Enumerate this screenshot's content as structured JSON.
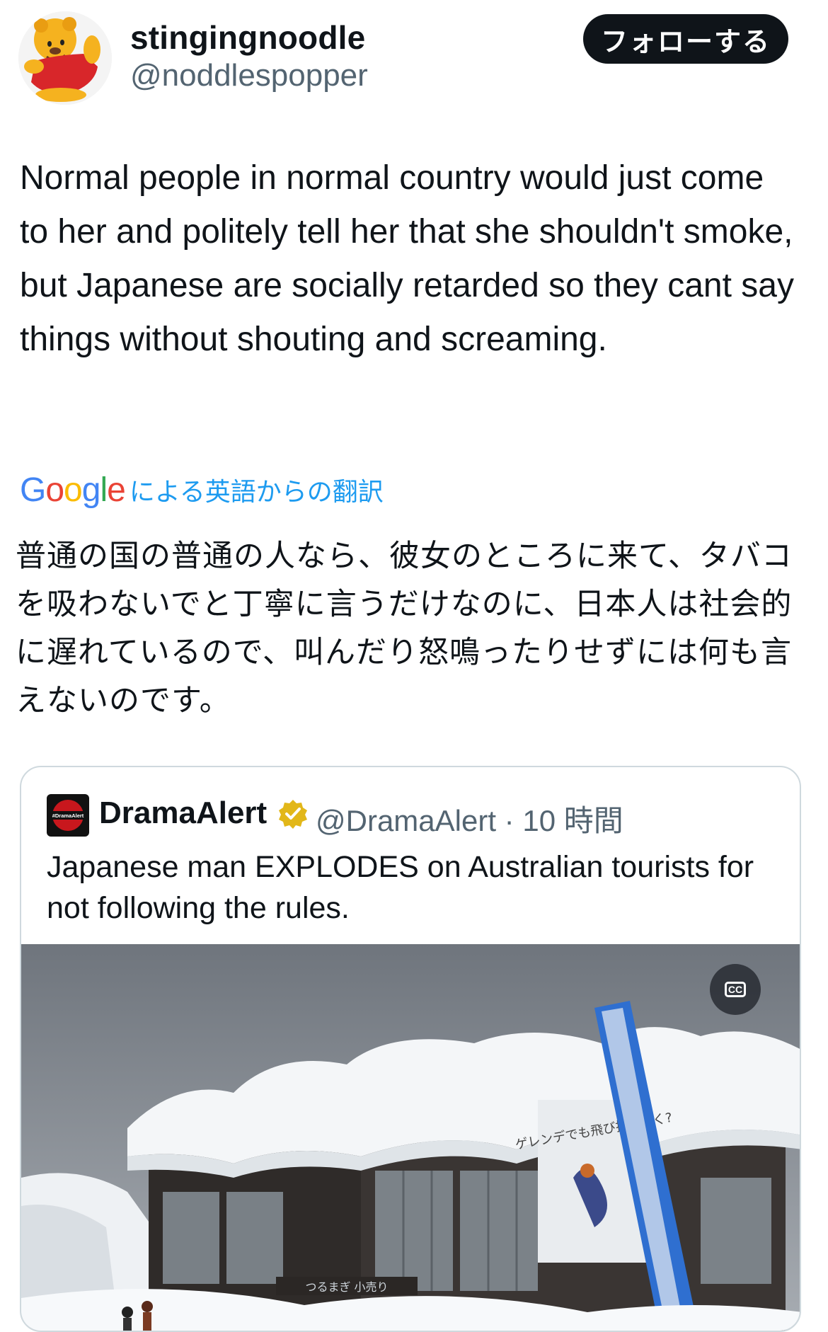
{
  "author": {
    "display_name": "stingingnoodle",
    "handle": "@noddlespopper",
    "avatar_icon": "pooh-bear-avatar"
  },
  "follow_button": {
    "label": "フォローする"
  },
  "tweet": {
    "text": "Normal people in normal country would just come to her and politely tell her that she shouldn't smoke, but Japanese are socially retarded so they cant say things without shouting and screaming."
  },
  "translation": {
    "provider": "Google",
    "label": "による英語からの翻訳",
    "text": "普通の国の普通の人なら、彼女のところに来て、タバコを吸わないでと丁寧に言うだけなのに、日本人は社会的に遅れているので、叫んだり怒鳴ったりせずには何も言えないのです。"
  },
  "quote": {
    "display_name": "DramaAlert",
    "handle_time": "@DramaAlert · 10 時間",
    "avatar_text": "#DramaAlert",
    "verified_icon": "gold-verified-badge-icon",
    "text": "Japanese man EXPLODES on Australian tourists for not following the rules.",
    "media": {
      "sign_text": "ゲレンデでも飛び抜けとく?",
      "store_text": "つるまぎ 小売り",
      "cc_label": "CC"
    }
  },
  "colors": {
    "text": "#0f1419",
    "secondary": "#536471",
    "link": "#1d9bf0",
    "border": "#cfd9de",
    "badge_gold": "#e2b719"
  }
}
